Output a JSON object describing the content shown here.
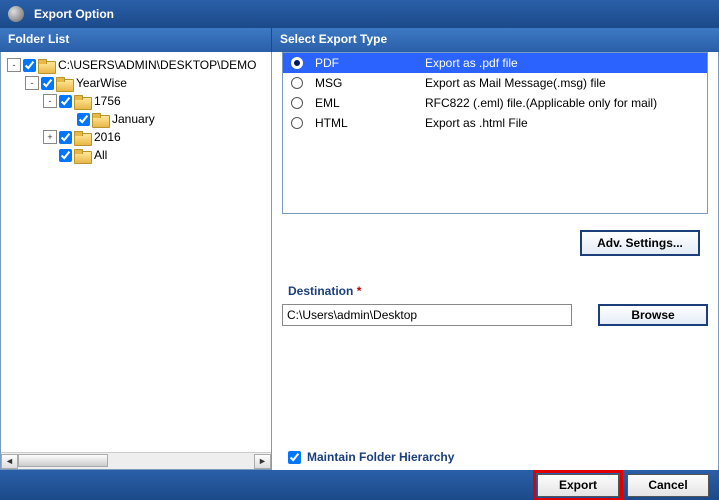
{
  "title": "Export Option",
  "headers": {
    "folder_list": "Folder List",
    "export_type": "Select Export Type"
  },
  "tree": [
    {
      "depth": 0,
      "twisty": "-",
      "checked": true,
      "label": "C:\\USERS\\ADMIN\\DESKTOP\\DEMO"
    },
    {
      "depth": 1,
      "twisty": "-",
      "checked": true,
      "label": "YearWise"
    },
    {
      "depth": 2,
      "twisty": "-",
      "checked": true,
      "label": "1756"
    },
    {
      "depth": 3,
      "twisty": "",
      "checked": true,
      "label": "January"
    },
    {
      "depth": 2,
      "twisty": "+",
      "checked": true,
      "label": "2016"
    },
    {
      "depth": 2,
      "twisty": "",
      "checked": true,
      "label": "All"
    }
  ],
  "types": [
    {
      "code": "PDF",
      "desc": "Export as .pdf file",
      "selected": true
    },
    {
      "code": "MSG",
      "desc": "Export as Mail Message(.msg) file",
      "selected": false
    },
    {
      "code": "EML",
      "desc": "RFC822 (.eml) file.(Applicable only for mail)",
      "selected": false
    },
    {
      "code": "HTML",
      "desc": "Export as .html File",
      "selected": false
    }
  ],
  "buttons": {
    "adv": "Adv. Settings...",
    "browse": "Browse",
    "export": "Export",
    "cancel": "Cancel"
  },
  "destination": {
    "label": "Destination",
    "asterisk": "*",
    "value": "C:\\Users\\admin\\Desktop"
  },
  "maintain": {
    "label": "Maintain Folder Hierarchy",
    "checked": true
  }
}
